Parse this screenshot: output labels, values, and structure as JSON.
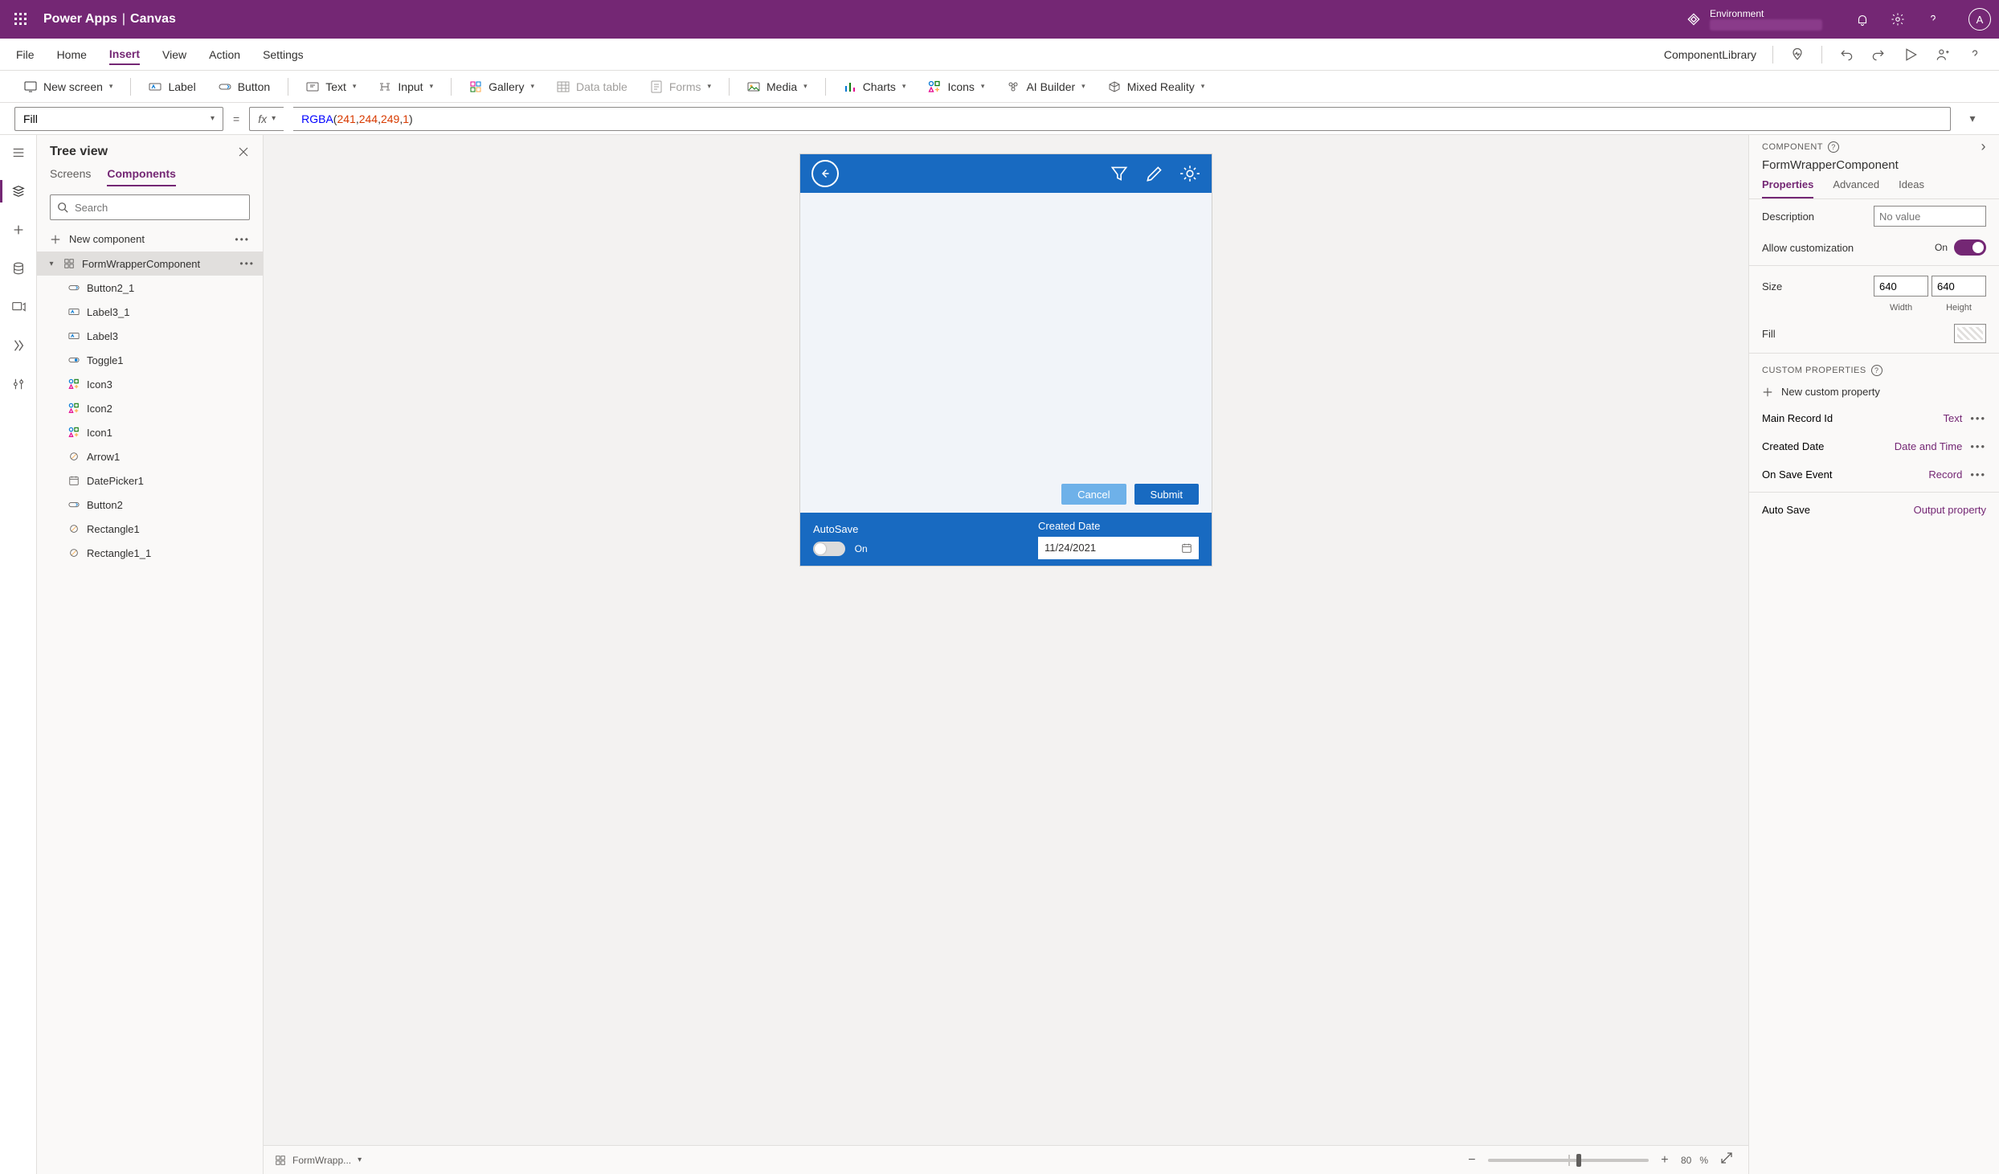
{
  "header": {
    "brand_app": "Power Apps",
    "brand_page": "Canvas",
    "environment_label": "Environment",
    "avatar_letter": "A"
  },
  "menu": {
    "items": [
      "File",
      "Home",
      "Insert",
      "View",
      "Action",
      "Settings"
    ],
    "active_index": 2,
    "right_label": "ComponentLibrary"
  },
  "ribbon": {
    "items": [
      {
        "label": "New screen",
        "dropdown": true
      },
      {
        "sep": true
      },
      {
        "label": "Label"
      },
      {
        "label": "Button"
      },
      {
        "sep": true
      },
      {
        "label": "Text",
        "dropdown": true
      },
      {
        "label": "Input",
        "dropdown": true
      },
      {
        "sep": true
      },
      {
        "label": "Gallery",
        "dropdown": true
      },
      {
        "label": "Data table",
        "disabled": true
      },
      {
        "label": "Forms",
        "dropdown": true,
        "disabled": true
      },
      {
        "sep": true
      },
      {
        "label": "Media",
        "dropdown": true
      },
      {
        "sep": true
      },
      {
        "label": "Charts",
        "dropdown": true
      },
      {
        "label": "Icons",
        "dropdown": true
      },
      {
        "label": "AI Builder",
        "dropdown": true
      },
      {
        "label": "Mixed Reality",
        "dropdown": true
      }
    ]
  },
  "formula": {
    "property": "Fill",
    "fx_label": "fx",
    "expr_fn": "RGBA",
    "expr_args": [
      "241",
      "244",
      "249",
      "1"
    ]
  },
  "tree": {
    "title": "Tree view",
    "tabs": [
      "Screens",
      "Components"
    ],
    "active_tab": 1,
    "search_placeholder": "Search",
    "new_component_label": "New component",
    "items": [
      {
        "name": "FormWrapperComponent",
        "icon": "component-icon",
        "selected": true,
        "expanded": true
      },
      {
        "name": "Button2_1",
        "icon": "button-icon",
        "child": true
      },
      {
        "name": "Label3_1",
        "icon": "label-icon",
        "child": true
      },
      {
        "name": "Label3",
        "icon": "label-icon",
        "child": true
      },
      {
        "name": "Toggle1",
        "icon": "toggle-icon",
        "child": true
      },
      {
        "name": "Icon3",
        "icon": "icons-icon",
        "child": true
      },
      {
        "name": "Icon2",
        "icon": "icons-icon",
        "child": true
      },
      {
        "name": "Icon1",
        "icon": "icons-icon",
        "child": true
      },
      {
        "name": "Arrow1",
        "icon": "shape-icon",
        "child": true
      },
      {
        "name": "DatePicker1",
        "icon": "calendar-icon",
        "child": true
      },
      {
        "name": "Button2",
        "icon": "button-icon",
        "child": true
      },
      {
        "name": "Rectangle1",
        "icon": "shape-icon",
        "child": true
      },
      {
        "name": "Rectangle1_1",
        "icon": "shape-icon",
        "child": true
      }
    ]
  },
  "canvas": {
    "component": {
      "cancel_label": "Cancel",
      "submit_label": "Submit",
      "autosave_label": "AutoSave",
      "autosave_value_label": "On",
      "created_date_label": "Created Date",
      "created_date_value": "11/24/2021"
    },
    "footer": {
      "breadcrumb": "FormWrapp...",
      "zoom_value": "80",
      "zoom_unit": "%"
    }
  },
  "properties": {
    "section_label": "COMPONENT",
    "component_name": "FormWrapperComponent",
    "tabs": [
      "Properties",
      "Advanced",
      "Ideas"
    ],
    "active_tab": 0,
    "description_label": "Description",
    "description_placeholder": "No value",
    "allow_custom_label": "Allow customization",
    "allow_custom_value": "On",
    "size_label": "Size",
    "width_value": "640",
    "height_value": "640",
    "width_label": "Width",
    "height_label": "Height",
    "fill_label": "Fill",
    "custom_props_label": "CUSTOM PROPERTIES",
    "new_prop_label": "New custom property",
    "custom_props": [
      {
        "name": "Main Record Id",
        "type": "Text"
      },
      {
        "name": "Created Date",
        "type": "Date and Time"
      },
      {
        "name": "On Save Event",
        "type": "Record"
      },
      {
        "name": "Auto Save",
        "type": "Output property"
      }
    ]
  }
}
